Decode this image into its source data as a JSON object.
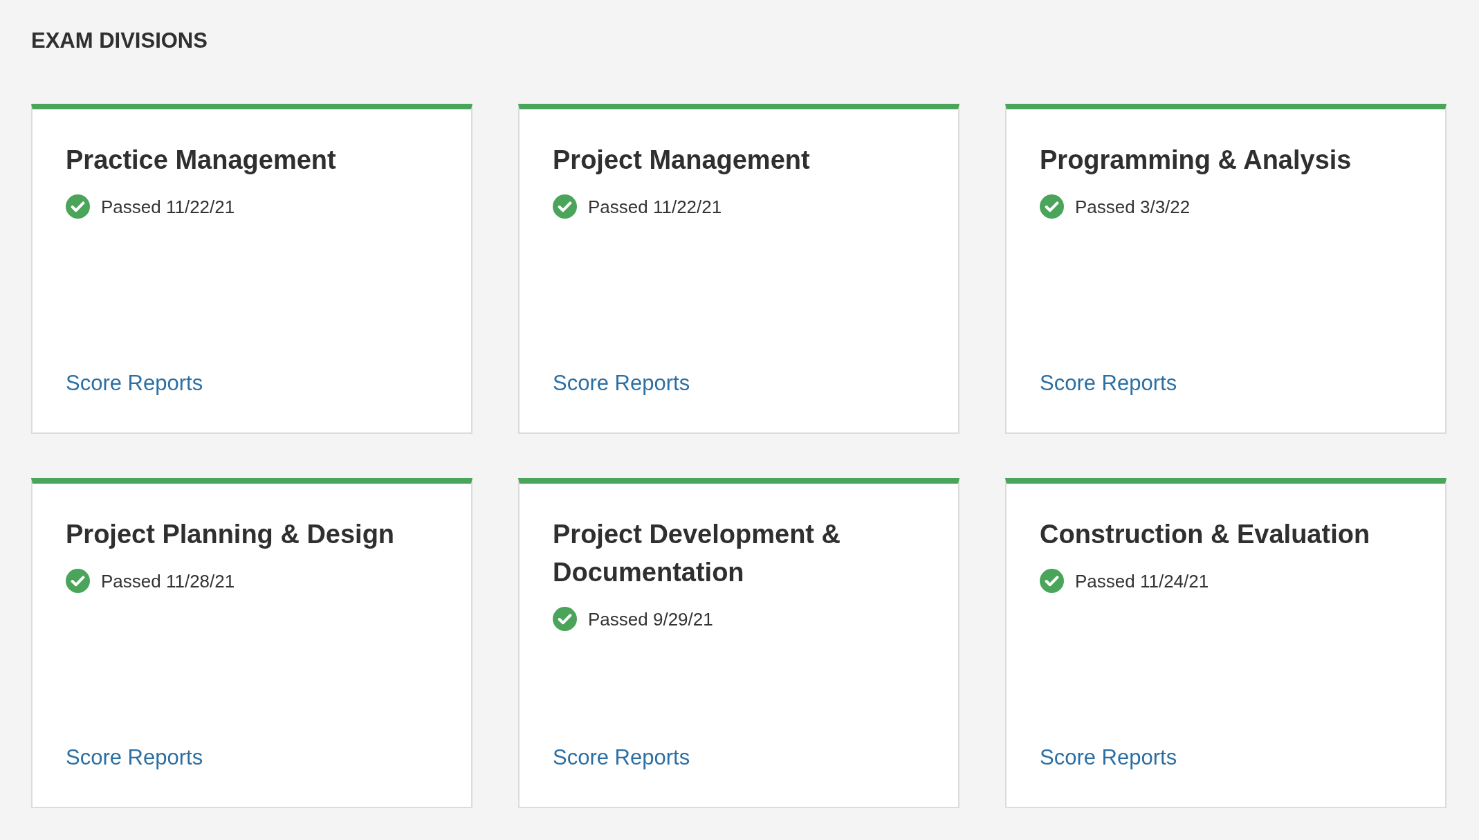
{
  "heading": "EXAM DIVISIONS",
  "divisions": [
    {
      "title": "Practice Management",
      "passed": true,
      "status": "Passed 11/22/21",
      "link": "Score Reports"
    },
    {
      "title": "Project Management",
      "passed": true,
      "status": "Passed 11/22/21",
      "link": "Score Reports"
    },
    {
      "title": "Programming & Analysis",
      "passed": true,
      "status": "Passed 3/3/22",
      "link": "Score Reports"
    },
    {
      "title": "Project Planning & Design",
      "passed": true,
      "status": "Passed 11/28/21",
      "link": "Score Reports"
    },
    {
      "title": "Project Development & Documentation",
      "passed": true,
      "status": "Passed 9/29/21",
      "link": "Score Reports"
    },
    {
      "title": "Construction & Evaluation",
      "passed": true,
      "status": "Passed 11/24/21",
      "link": "Score Reports"
    }
  ]
}
